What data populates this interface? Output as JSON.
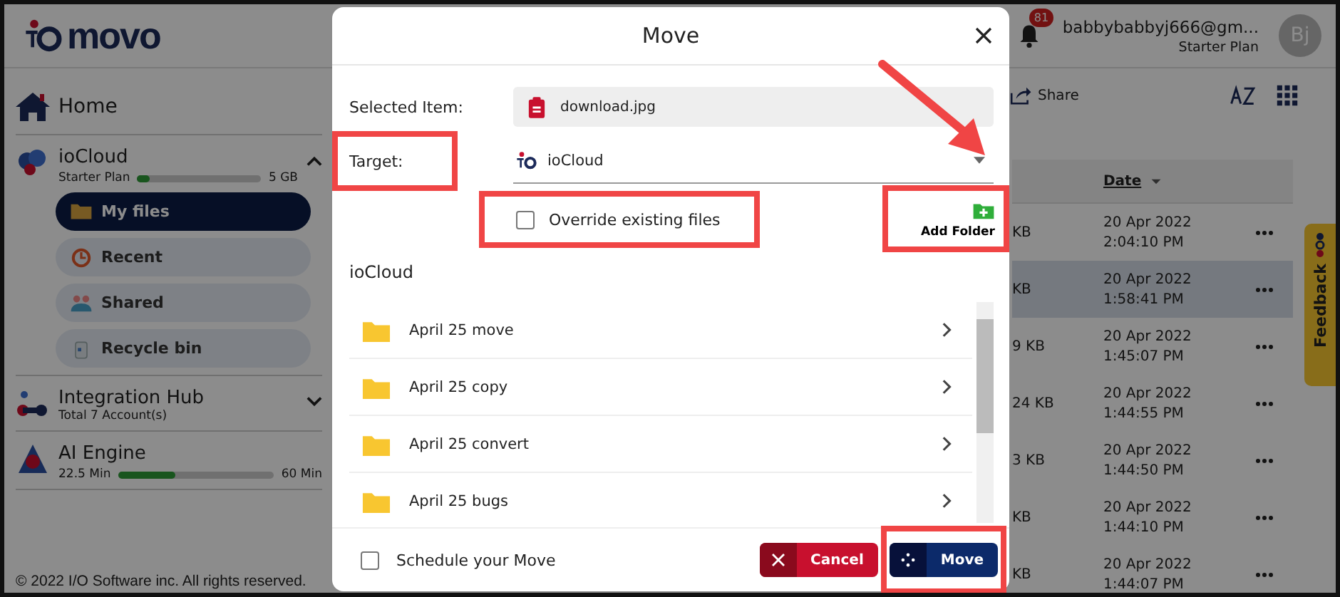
{
  "header": {
    "logo": "movo",
    "notifications": "81",
    "account": {
      "email": "babbybabbyj666@gm...",
      "plan": "Starter Plan",
      "initials": "Bj"
    }
  },
  "sidebar": {
    "home": "Home",
    "sections": [
      {
        "kind": "cloud",
        "title": "ioCloud",
        "expanded": true,
        "caption": "Starter Plan",
        "level": 0.1,
        "limit": "5 GB",
        "items": [
          {
            "label": "My files",
            "selected": true
          },
          {
            "label": "Recent",
            "selected": false
          },
          {
            "label": "Shared",
            "selected": false
          },
          {
            "label": "Recycle bin",
            "selected": false
          }
        ]
      },
      {
        "kind": "hub",
        "title": "Integration Hub",
        "expanded": false,
        "caption": "Total 7 Account(s)"
      },
      {
        "kind": "ai",
        "title": "AI Engine",
        "used": "22.5 Min",
        "level": 0.37,
        "limit": "60 Min"
      }
    ],
    "footer": "© 2022 I/O Software inc. All rights reserved."
  },
  "toolbar": {
    "share": "Share"
  },
  "table": {
    "columns": [
      "Date"
    ],
    "rows": [
      {
        "size": "KB",
        "date": "20 Apr 2022",
        "time": "2:04:10 PM",
        "selected": false
      },
      {
        "size": "KB",
        "date": "20 Apr 2022",
        "time": "1:58:41 PM",
        "selected": true
      },
      {
        "size": "9 KB",
        "date": "20 Apr 2022",
        "time": "1:45:07 PM",
        "selected": false
      },
      {
        "size": "24 KB",
        "date": "20 Apr 2022",
        "time": "1:44:55 PM",
        "selected": false
      },
      {
        "size": "3 KB",
        "date": "20 Apr 2022",
        "time": "1:44:50 PM",
        "selected": false
      },
      {
        "size": "KB",
        "date": "20 Apr 2022",
        "time": "1:44:10 PM",
        "selected": false
      },
      {
        "size": "KB",
        "date": "20 Apr 2022",
        "time": "1:44:07 PM",
        "selected": false
      }
    ]
  },
  "feedback": "Feedback",
  "dialog": {
    "title": "Move",
    "selected_item": {
      "label": "Selected Item:",
      "value": "download.jpg"
    },
    "target": {
      "label": "Target:",
      "value": "ioCloud",
      "highlighted": true
    },
    "override": {
      "label": "Override existing files",
      "checked": false,
      "highlighted": true
    },
    "add_folder": {
      "label": "Add Folder",
      "highlighted": true
    },
    "location": "ioCloud",
    "folders": [
      "April 25 move",
      "April 25 copy",
      "April 25 convert",
      "April 25 bugs"
    ],
    "schedule": {
      "label": "Schedule your Move",
      "checked": false
    },
    "buttons": [
      {
        "kind": "cancel",
        "label": "Cancel",
        "highlighted": false
      },
      {
        "kind": "move",
        "label": "Move",
        "highlighted": true
      }
    ]
  }
}
